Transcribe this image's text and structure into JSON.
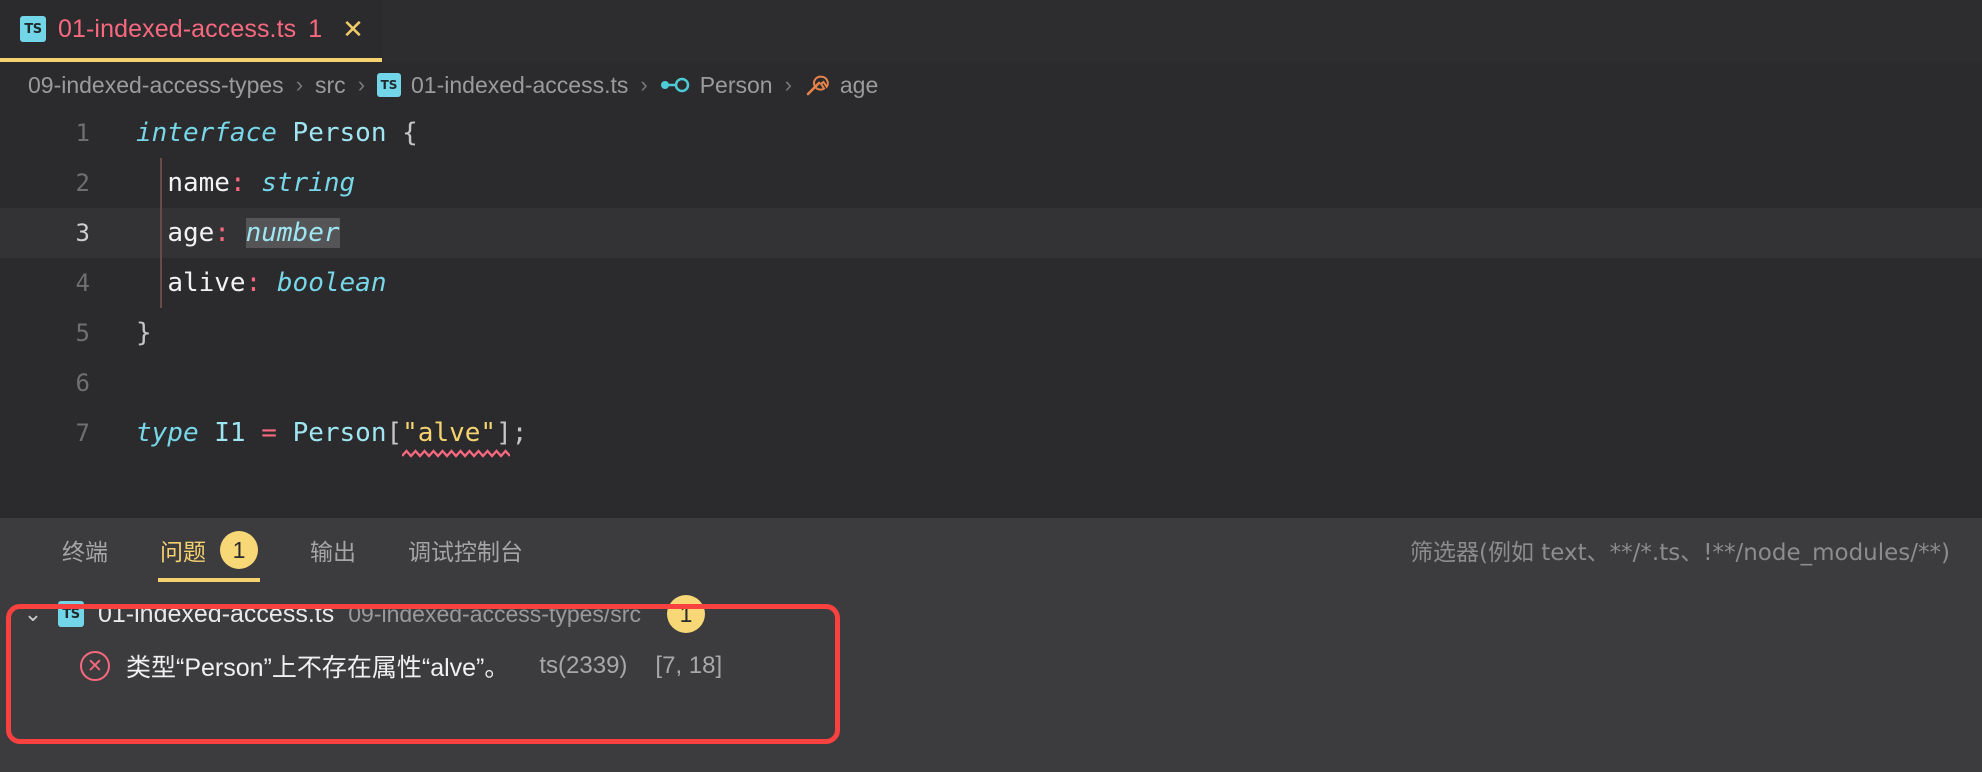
{
  "editor_tab": {
    "icon": "typescript-file-icon",
    "icon_label": "TS",
    "title": "01-indexed-access.ts",
    "problem_count": "1",
    "close_label": "✕"
  },
  "breadcrumbs": {
    "separator": "›",
    "items": [
      {
        "label": "09-indexed-access-types",
        "icon": ""
      },
      {
        "label": "src",
        "icon": ""
      },
      {
        "label": "01-indexed-access.ts",
        "icon": "typescript-file-icon"
      },
      {
        "label": "Person",
        "icon": "interface-symbol-icon"
      },
      {
        "label": "age",
        "icon": "property-symbol-icon"
      }
    ]
  },
  "code": {
    "lines": [
      {
        "num": "1",
        "active": false,
        "guide": false
      },
      {
        "num": "2",
        "active": false,
        "guide": true
      },
      {
        "num": "3",
        "active": true,
        "guide": true
      },
      {
        "num": "4",
        "active": false,
        "guide": true
      },
      {
        "num": "5",
        "active": false,
        "guide": false
      },
      {
        "num": "6",
        "active": false,
        "guide": false
      },
      {
        "num": "7",
        "active": false,
        "guide": false
      }
    ],
    "line1": {
      "kw": "interface",
      "name": "Person",
      "brace": "{"
    },
    "line2": {
      "prop": "name",
      "colon": ":",
      "type": "string"
    },
    "line3": {
      "prop": "age",
      "colon": ":",
      "type": "number"
    },
    "line4": {
      "prop": "alive",
      "colon": ":",
      "type": "boolean"
    },
    "line5": {
      "brace": "}"
    },
    "line7": {
      "kw": "type",
      "name": "I1",
      "eq": "=",
      "target": "Person",
      "open": "[",
      "str": "\"alve\"",
      "close": "]",
      "semi": ";"
    }
  },
  "panel": {
    "tabs": [
      {
        "label": "终端",
        "active": false,
        "badge": ""
      },
      {
        "label": "问题",
        "active": true,
        "badge": "1"
      },
      {
        "label": "输出",
        "active": false,
        "badge": ""
      },
      {
        "label": "调试控制台",
        "active": false,
        "badge": ""
      }
    ],
    "filter_placeholder": "筛选器(例如 text、**/*.ts、!**/node_modules/**)",
    "problem_group": {
      "chevron": "⌄",
      "icon_label": "TS",
      "file_name": "01-indexed-access.ts",
      "file_path": "09-indexed-access-types/src",
      "count": "1"
    },
    "problem_item": {
      "severity_icon": "✕",
      "message": "类型“Person”上不存在属性“alve”。",
      "code": "ts(2339)",
      "position": "[7, 18]"
    }
  },
  "colors": {
    "accent_yellow": "#f5d16f",
    "error_red": "#f8697f",
    "annotation_red": "#f9413f",
    "type_cyan": "#77d7e8",
    "editor_bg": "#2b2b2d",
    "panel_bg": "#3c3c3e"
  }
}
